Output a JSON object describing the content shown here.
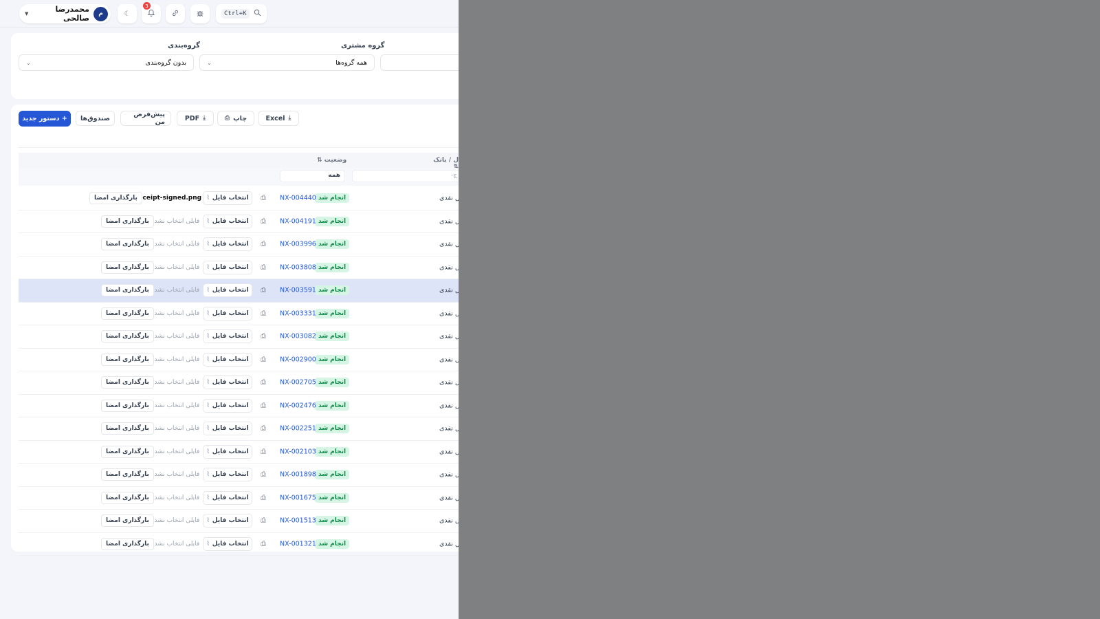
{
  "topbar": {
    "user_name": "محمدرضا صالحی",
    "avatar_letter": "م",
    "notifications_count": "3",
    "search_shortcut": "Ctrl+K"
  },
  "filters": {
    "grouping_label": "گروه‌بندی",
    "grouping_value": "بدون گروه‌بندی",
    "customer_group_label": "گروه مشتری",
    "customer_group_value": "همه گروه‌ها"
  },
  "toolbar": {
    "new_order": "+ دستور جدید",
    "boxes": "صندوق‌ها",
    "my_default": "پیش‌فرض من",
    "pdf": "PDF",
    "print": "چاپ",
    "excel": "Excel"
  },
  "table": {
    "headers": {
      "status": "وضعیت ⇅",
      "account_bank": "ل / بانک ⇅"
    },
    "filter_status": "همه",
    "filter_account_placeholder": "ج-",
    "rows": [
      {
        "type": "ل نقدی",
        "status": "انجام شد",
        "code": "NX-004440",
        "choose": "انتخاب فایل",
        "file": "receipt-signed.png",
        "upload": "بارگذاری امضا",
        "has_file": true
      },
      {
        "type": "ل نقدی",
        "status": "انجام شد",
        "code": "NX-004191",
        "choose": "انتخاب فایل",
        "file": "فایلی انتخاب نشده",
        "upload": "بارگذاری امضا",
        "has_file": false
      },
      {
        "type": "ل نقدی",
        "status": "انجام شد",
        "code": "NX-003996",
        "choose": "انتخاب فایل",
        "file": "فایلی انتخاب نشده",
        "upload": "بارگذاری امضا",
        "has_file": false
      },
      {
        "type": "ل نقدی",
        "status": "انجام شد",
        "code": "NX-003808",
        "choose": "انتخاب فایل",
        "file": "فایلی انتخاب نشده",
        "upload": "بارگذاری امضا",
        "has_file": false
      },
      {
        "type": "ل نقدی",
        "status": "انجام شد",
        "code": "NX-003591",
        "choose": "انتخاب فایل",
        "file": "فایلی انتخاب نشده",
        "upload": "بارگذاری امضا",
        "has_file": false,
        "selected": true
      },
      {
        "type": "ل نقدی",
        "status": "انجام شد",
        "code": "NX-003331",
        "choose": "انتخاب فایل",
        "file": "فایلی انتخاب نشده",
        "upload": "بارگذاری امضا",
        "has_file": false
      },
      {
        "type": "ل نقدی",
        "status": "انجام شد",
        "code": "NX-003082",
        "choose": "انتخاب فایل",
        "file": "فایلی انتخاب نشده",
        "upload": "بارگذاری امضا",
        "has_file": false
      },
      {
        "type": "ل نقدی",
        "status": "انجام شد",
        "code": "NX-002900",
        "choose": "انتخاب فایل",
        "file": "فایلی انتخاب نشده",
        "upload": "بارگذاری امضا",
        "has_file": false
      },
      {
        "type": "ل نقدی",
        "status": "انجام شد",
        "code": "NX-002705",
        "choose": "انتخاب فایل",
        "file": "فایلی انتخاب نشده",
        "upload": "بارگذاری امضا",
        "has_file": false
      },
      {
        "type": "ل نقدی",
        "status": "انجام شد",
        "code": "NX-002476",
        "choose": "انتخاب فایل",
        "file": "فایلی انتخاب نشده",
        "upload": "بارگذاری امضا",
        "has_file": false
      },
      {
        "type": "ل نقدی",
        "status": "انجام شد",
        "code": "NX-002251",
        "choose": "انتخاب فایل",
        "file": "فایلی انتخاب نشده",
        "upload": "بارگذاری امضا",
        "has_file": false
      },
      {
        "type": "ل نقدی",
        "status": "انجام شد",
        "code": "NX-002103",
        "choose": "انتخاب فایل",
        "file": "فایلی انتخاب نشده",
        "upload": "بارگذاری امضا",
        "has_file": false
      },
      {
        "type": "ل نقدی",
        "status": "انجام شد",
        "code": "NX-001898",
        "choose": "انتخاب فایل",
        "file": "فایلی انتخاب نشده",
        "upload": "بارگذاری امضا",
        "has_file": false
      },
      {
        "type": "ل نقدی",
        "status": "انجام شد",
        "code": "NX-001675",
        "choose": "انتخاب فایل",
        "file": "فایلی انتخاب نشده",
        "upload": "بارگذاری امضا",
        "has_file": false
      },
      {
        "type": "ل نقدی",
        "status": "انجام شد",
        "code": "NX-001513",
        "choose": "انتخاب فایل",
        "file": "فایلی انتخاب نشده",
        "upload": "بارگذاری امضا",
        "has_file": false
      },
      {
        "type": "ل نقدی",
        "status": "انجام شد",
        "code": "NX-001321",
        "choose": "انتخاب فایل",
        "file": "فایلی انتخاب نشده",
        "upload": "بارگذاری امضا",
        "has_file": false
      }
    ]
  },
  "colors": {
    "primary": "#2456d6",
    "success_bg": "#d6f5e4",
    "success_text": "#0f8a4a",
    "overlay": "#7f8081",
    "selected_row": "#dde4f8"
  },
  "icons": [
    "chevron-down-icon",
    "moon-icon",
    "bell-icon",
    "link-icon",
    "bug-icon",
    "search-icon",
    "download-icon",
    "printer-icon",
    "paperclip-icon"
  ]
}
